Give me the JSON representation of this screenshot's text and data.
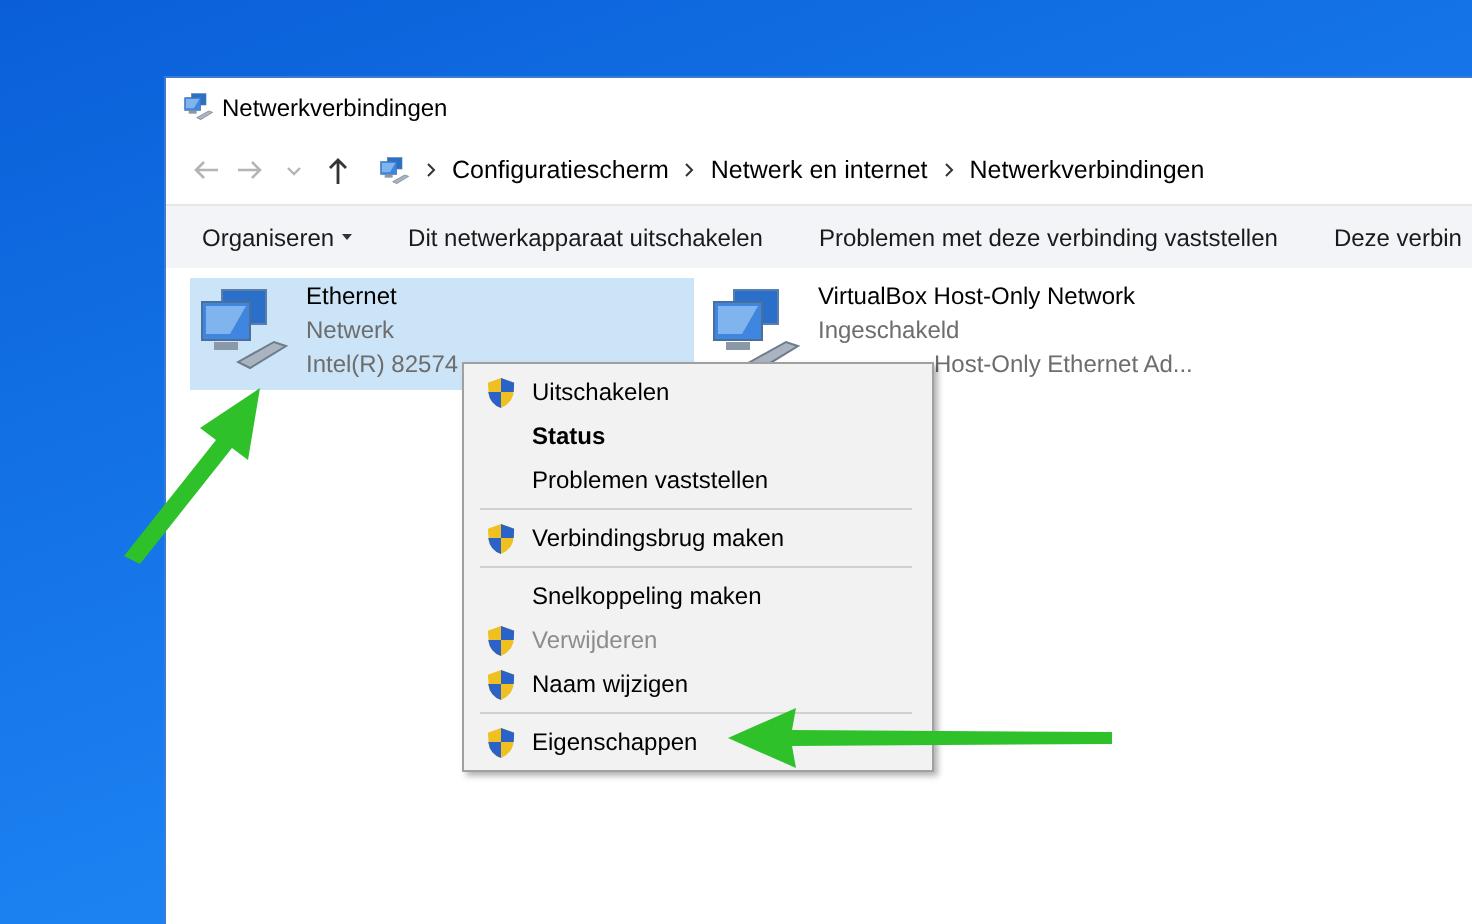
{
  "window": {
    "title": "Netwerkverbindingen"
  },
  "address_bar": {
    "crumbs": [
      "Configuratiescherm",
      "Netwerk en internet",
      "Netwerkverbindingen"
    ]
  },
  "toolbar": [
    {
      "label": "Organiseren",
      "dropdown": true
    },
    {
      "label": "Dit netwerkapparaat uitschakelen",
      "dropdown": false
    },
    {
      "label": "Problemen met deze verbinding vaststellen",
      "dropdown": false
    },
    {
      "label": "Deze verbin",
      "dropdown": false
    }
  ],
  "connections": [
    {
      "name": "Ethernet",
      "status": "Netwerk",
      "adapter": "Intel(R) 82574",
      "selected": true
    },
    {
      "name": "VirtualBox Host-Only Network",
      "status": "Ingeschakeld",
      "adapter": "Host-Only Ethernet Ad...",
      "selected": false
    }
  ],
  "context_menu": [
    {
      "kind": "item",
      "label": "Uitschakelen",
      "shield": true,
      "default": false,
      "disabled": false
    },
    {
      "kind": "item",
      "label": "Status",
      "shield": false,
      "default": true,
      "disabled": false
    },
    {
      "kind": "item",
      "label": "Problemen vaststellen",
      "shield": false,
      "default": false,
      "disabled": false
    },
    {
      "kind": "separator"
    },
    {
      "kind": "item",
      "label": "Verbindingsbrug maken",
      "shield": true,
      "default": false,
      "disabled": false
    },
    {
      "kind": "separator"
    },
    {
      "kind": "item",
      "label": "Snelkoppeling maken",
      "shield": false,
      "default": false,
      "disabled": false
    },
    {
      "kind": "item",
      "label": "Verwijderen",
      "shield": true,
      "default": false,
      "disabled": true
    },
    {
      "kind": "item",
      "label": "Naam wijzigen",
      "shield": true,
      "default": false,
      "disabled": false
    },
    {
      "kind": "separator"
    },
    {
      "kind": "item",
      "label": "Eigenschappen",
      "shield": true,
      "default": false,
      "disabled": false
    }
  ]
}
